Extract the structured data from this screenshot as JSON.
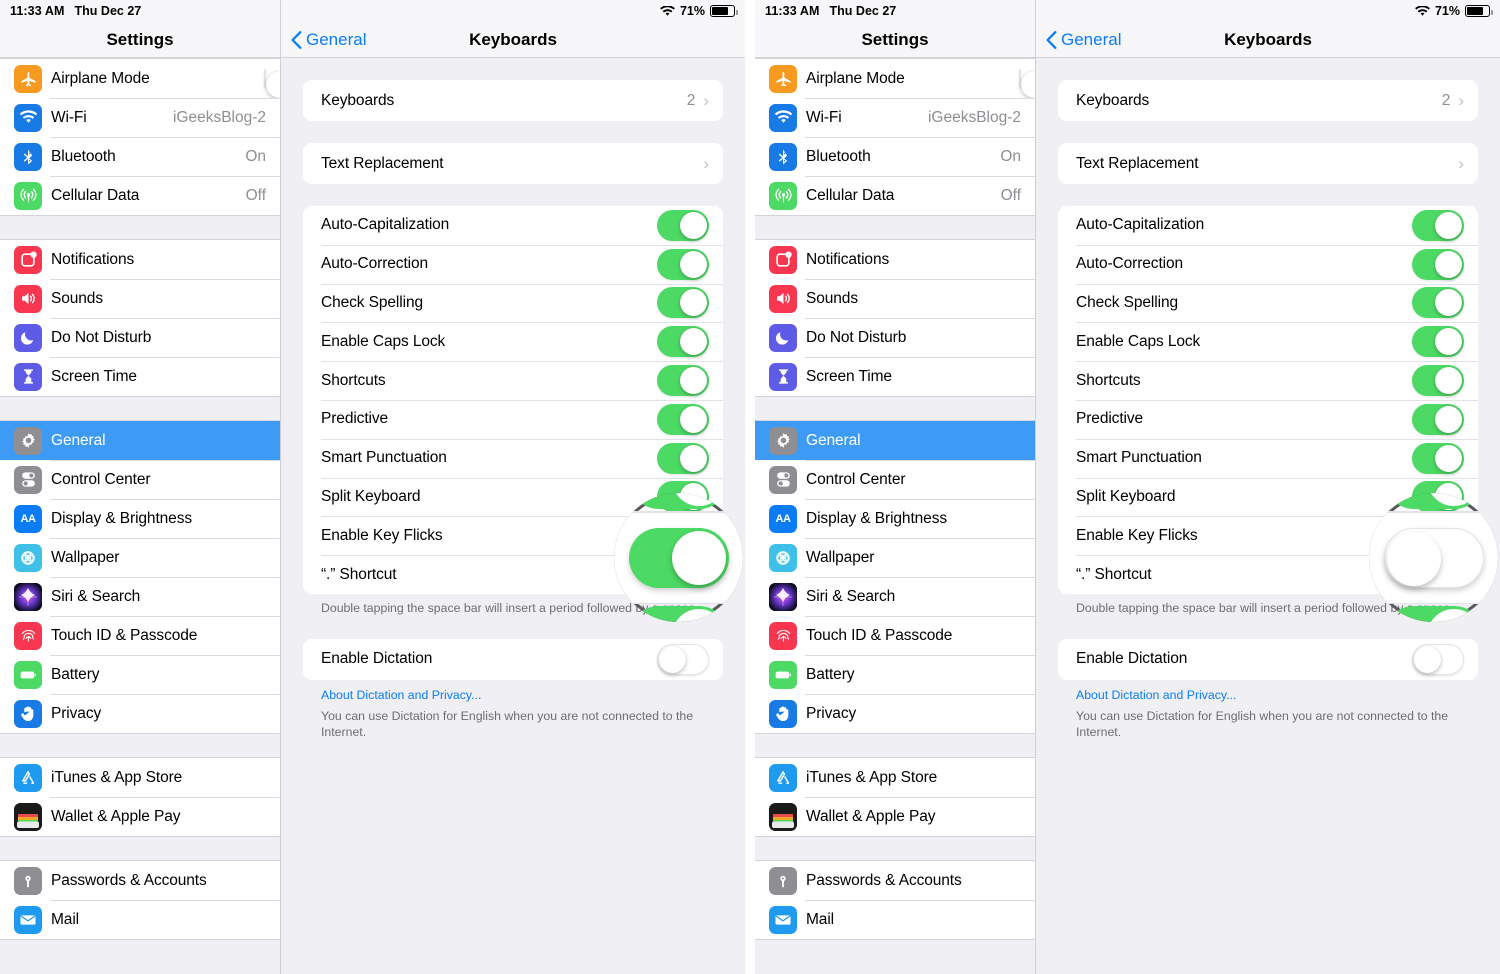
{
  "statusbar": {
    "time": "11:33 AM",
    "date": "Thu Dec 27",
    "battery_percent": "71%",
    "wifi_icon": "wifi-icon",
    "battery_icon": "battery-icon"
  },
  "sidebar": {
    "title": "Settings",
    "groups": [
      {
        "items": [
          {
            "label": "Airplane Mode",
            "icon": "airplane-icon",
            "control": "toggle",
            "value": "off"
          },
          {
            "label": "Wi-Fi",
            "icon": "wifi-icon",
            "control": "value",
            "value": "iGeeksBlog-2"
          },
          {
            "label": "Bluetooth",
            "icon": "bluetooth-icon",
            "control": "value",
            "value": "On"
          },
          {
            "label": "Cellular Data",
            "icon": "cellular-icon",
            "control": "value",
            "value": "Off"
          }
        ]
      },
      {
        "items": [
          {
            "label": "Notifications",
            "icon": "notifications-icon",
            "control": "none",
            "value": ""
          },
          {
            "label": "Sounds",
            "icon": "sounds-icon",
            "control": "none",
            "value": ""
          },
          {
            "label": "Do Not Disturb",
            "icon": "do-not-disturb-icon",
            "control": "none",
            "value": ""
          },
          {
            "label": "Screen Time",
            "icon": "screen-time-icon",
            "control": "none",
            "value": ""
          }
        ]
      },
      {
        "items": [
          {
            "label": "General",
            "icon": "gear-icon",
            "control": "none",
            "value": "",
            "selected": true
          },
          {
            "label": "Control Center",
            "icon": "control-center-icon",
            "control": "none",
            "value": ""
          },
          {
            "label": "Display & Brightness",
            "icon": "display-brightness-icon",
            "control": "none",
            "value": ""
          },
          {
            "label": "Wallpaper",
            "icon": "wallpaper-icon",
            "control": "none",
            "value": ""
          },
          {
            "label": "Siri & Search",
            "icon": "siri-icon",
            "control": "none",
            "value": ""
          },
          {
            "label": "Touch ID & Passcode",
            "icon": "touch-id-icon",
            "control": "none",
            "value": ""
          },
          {
            "label": "Battery",
            "icon": "battery-icon",
            "control": "none",
            "value": ""
          },
          {
            "label": "Privacy",
            "icon": "privacy-icon",
            "control": "none",
            "value": ""
          }
        ]
      },
      {
        "items": [
          {
            "label": "iTunes & App Store",
            "icon": "app-store-icon",
            "control": "none",
            "value": ""
          },
          {
            "label": "Wallet & Apple Pay",
            "icon": "wallet-icon",
            "control": "none",
            "value": ""
          }
        ]
      },
      {
        "items": [
          {
            "label": "Passwords & Accounts",
            "icon": "key-icon",
            "control": "none",
            "value": ""
          },
          {
            "label": "Mail",
            "icon": "mail-icon",
            "control": "none",
            "value": ""
          }
        ]
      }
    ]
  },
  "detail": {
    "back_label": "General",
    "back_icon": "chevron-left-icon",
    "title": "Keyboards",
    "nav_rows": [
      {
        "label": "Keyboards",
        "value": "2",
        "chevron": "›"
      },
      {
        "label": "Text Replacement",
        "value": "",
        "chevron": "›"
      }
    ],
    "switch_rows": [
      {
        "label": "Auto-Capitalization",
        "state": "on"
      },
      {
        "label": "Auto-Correction",
        "state": "on"
      },
      {
        "label": "Check Spelling",
        "state": "on"
      },
      {
        "label": "Enable Caps Lock",
        "state": "on"
      },
      {
        "label": "Shortcuts",
        "state": "on"
      },
      {
        "label": "Predictive",
        "state": "on"
      },
      {
        "label": "Smart Punctuation",
        "state": "on"
      },
      {
        "label": "Split Keyboard",
        "state": "on"
      },
      {
        "label": "Enable Key Flicks",
        "state": "on"
      },
      {
        "label": "“.” Shortcut",
        "state": "on"
      }
    ],
    "switch_rows_right": [
      {
        "label": "Auto-Capitalization",
        "state": "on"
      },
      {
        "label": "Auto-Correction",
        "state": "on"
      },
      {
        "label": "Check Spelling",
        "state": "on"
      },
      {
        "label": "Enable Caps Lock",
        "state": "on"
      },
      {
        "label": "Shortcuts",
        "state": "on"
      },
      {
        "label": "Predictive",
        "state": "on"
      },
      {
        "label": "Smart Punctuation",
        "state": "on"
      },
      {
        "label": "Split Keyboard",
        "state": "on"
      },
      {
        "label": "Enable Key Flicks",
        "state": "off"
      },
      {
        "label": "“.” Shortcut",
        "state": "on"
      }
    ],
    "shortcut_footnote": "Double tapping the space bar will insert a period followed by a space.",
    "dictation_row": {
      "label": "Enable Dictation",
      "state": "off"
    },
    "dictation_link": "About Dictation and Privacy...",
    "dictation_footnote": "You can use Dictation for English when you are not connected to the Internet."
  },
  "annotations": {
    "left_magnifier": {
      "target": "Enable Key Flicks",
      "state": "on"
    },
    "right_magnifier": {
      "target": "Enable Key Flicks",
      "state": "off"
    }
  },
  "colors": {
    "accent_blue": "#0a7cf7",
    "selection_blue": "#3d9bf5",
    "toggle_green": "#4cd964",
    "background_gray": "#efeff4",
    "secondary_text": "#8e8e93"
  }
}
